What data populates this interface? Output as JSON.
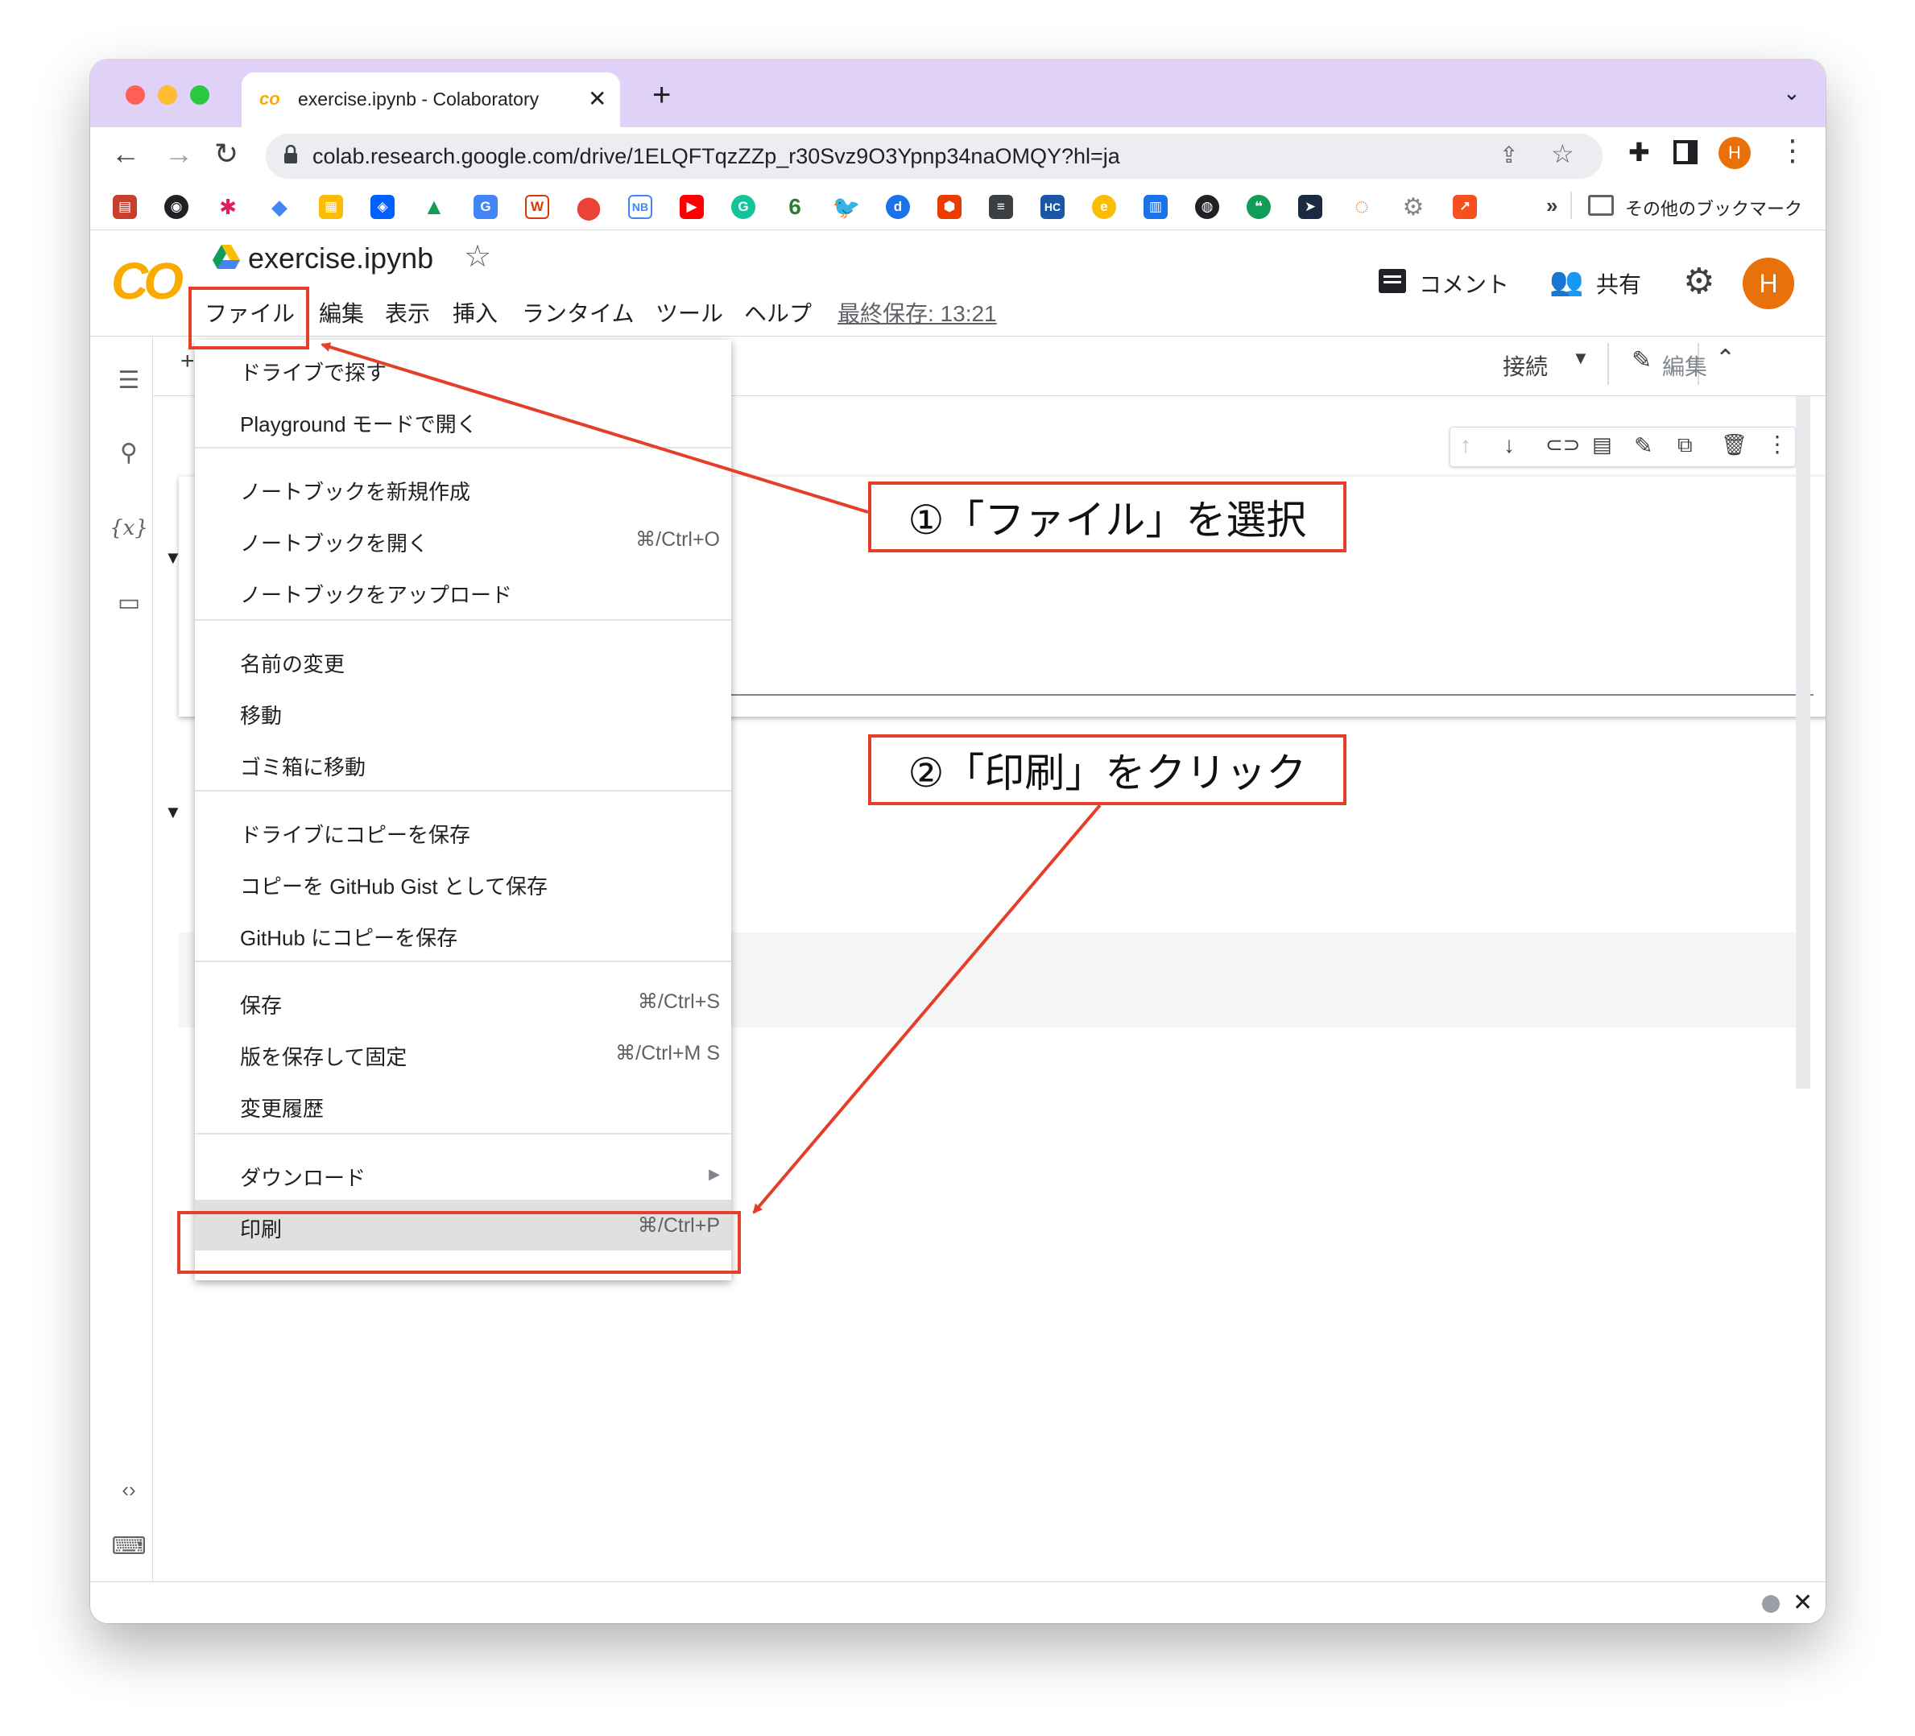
{
  "browser": {
    "tab_title": "exercise.ipynb - Colaboratory",
    "url": "colab.research.google.com/drive/1ELQFTqzZZp_r30Svz9O3Ypnp34naOMQY?hl=ja",
    "profile_initial": "H",
    "bookmarks_overflow": "»",
    "other_bookmarks": "その他のブックマーク"
  },
  "colab": {
    "logo": "CO",
    "filename": "exercise.ipynb",
    "menus": [
      "ファイル",
      "編集",
      "表示",
      "挿入",
      "ランタイム",
      "ツール",
      "ヘルプ"
    ],
    "last_saved": "最終保存: 13:21",
    "comment": "コメント",
    "share": "共有",
    "avatar": "H",
    "connect": "接続",
    "edit": "編集",
    "add_partial": "+"
  },
  "file_menu": {
    "items": [
      {
        "label": "ドライブで探す",
        "shortcut": ""
      },
      {
        "label": "Playground モードで開く",
        "shortcut": ""
      },
      {
        "label": "ノートブックを新規作成",
        "shortcut": ""
      },
      {
        "label": "ノートブックを開く",
        "shortcut": "⌘/Ctrl+O"
      },
      {
        "label": "ノートブックをアップロード",
        "shortcut": ""
      },
      {
        "label": "名前の変更",
        "shortcut": ""
      },
      {
        "label": "移動",
        "shortcut": ""
      },
      {
        "label": "ゴミ箱に移動",
        "shortcut": ""
      },
      {
        "label": "ドライブにコピーを保存",
        "shortcut": ""
      },
      {
        "label": "コピーを GitHub Gist として保存",
        "shortcut": ""
      },
      {
        "label": "GitHub にコピーを保存",
        "shortcut": ""
      },
      {
        "label": "保存",
        "shortcut": "⌘/Ctrl+S"
      },
      {
        "label": "版を保存して固定",
        "shortcut": "⌘/Ctrl+M S"
      },
      {
        "label": "変更履歴",
        "shortcut": ""
      },
      {
        "label": "ダウンロード",
        "shortcut": "▶"
      },
      {
        "label": "印刷",
        "shortcut": "⌘/Ctrl+P"
      }
    ]
  },
  "annotations": {
    "step1": "①「ファイル」を選択",
    "step2": "②「印刷」をクリック"
  },
  "colors": {
    "accent_red": "#e53e2b",
    "titlebar": "#e0d2f7",
    "colab_orange": "#f9ab00",
    "avatar": "#e8710a"
  }
}
